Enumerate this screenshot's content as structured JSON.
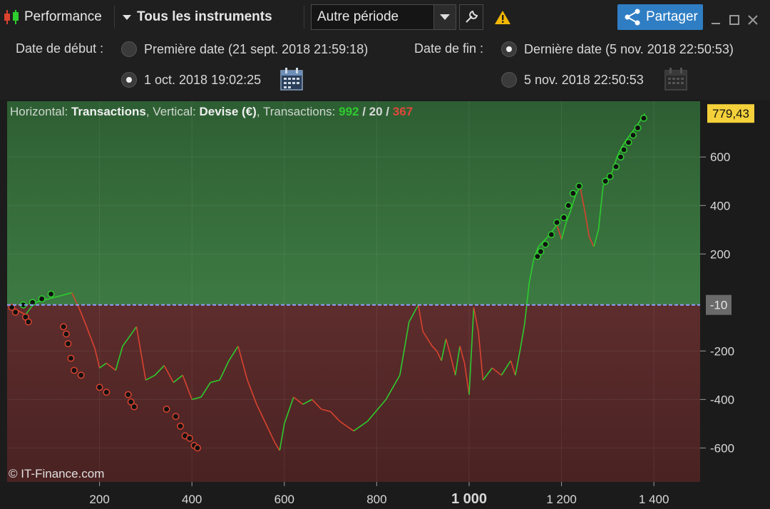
{
  "toolbar": {
    "performance_label": "Performance",
    "instruments_label": "Tous les instruments",
    "period_value": "Autre période",
    "share_label": "Partager",
    "icons": [
      "candlestick-icon",
      "caret-down-icon",
      "chevron-down-icon",
      "wrench-icon",
      "warning-icon",
      "share-icon",
      "minimize-icon",
      "maximize-icon",
      "close-icon"
    ]
  },
  "params": {
    "start_label": "Date de début :",
    "start_option_first": "Première date (21 sept. 2018 21:59:18)",
    "start_option_custom": "1 oct. 2018 19:02:25",
    "start_selected": "custom",
    "end_label": "Date de fin :",
    "end_option_last": "Dernière date (5 nov. 2018 22:50:53)",
    "end_option_custom": "5 nov. 2018 22:50:53",
    "end_selected": "last"
  },
  "chart_data": {
    "type": "line",
    "info": {
      "horizontal_label": "Horizontal: ",
      "horizontal_value": "Transactions",
      "vertical_label": ", Vertical: ",
      "vertical_value": "Devise (€)",
      "transactions_label": ", Transactions: ",
      "transactions_win": "992",
      "sep1": " / ",
      "transactions_neutral": "20",
      "sep2": " / ",
      "transactions_loss": "367"
    },
    "xlim": [
      0,
      1500
    ],
    "ylim": [
      -740,
      830
    ],
    "x_ticks": [
      200,
      400,
      600,
      800,
      1000,
      1200,
      1400
    ],
    "x_tick_labels": [
      "200",
      "400",
      "600",
      "800",
      "1 000",
      "1 200",
      "1 400"
    ],
    "y_ticks": [
      -600,
      -400,
      -200,
      200,
      400,
      600
    ],
    "y_tick_labels": [
      "-600",
      "-400",
      "-200",
      "200",
      "400",
      "600"
    ],
    "zero_line_value": -10,
    "zero_line_label": "-10",
    "last_value": 779.43,
    "last_value_label": "779,43",
    "series": [
      {
        "points": [
          [
            0,
            -10
          ],
          [
            20,
            -30
          ],
          [
            40,
            -50
          ],
          [
            60,
            0
          ],
          [
            80,
            10
          ],
          [
            100,
            20
          ],
          [
            120,
            30
          ],
          [
            140,
            40
          ],
          [
            155,
            -20
          ],
          [
            170,
            -90
          ],
          [
            190,
            -190
          ],
          [
            200,
            -270
          ],
          [
            215,
            -250
          ],
          [
            235,
            -280
          ],
          [
            250,
            -180
          ],
          [
            280,
            -100
          ],
          [
            300,
            -320
          ],
          [
            320,
            -300
          ],
          [
            340,
            -260
          ],
          [
            360,
            -330
          ],
          [
            380,
            -300
          ],
          [
            400,
            -400
          ],
          [
            420,
            -390
          ],
          [
            440,
            -330
          ],
          [
            460,
            -320
          ],
          [
            480,
            -240
          ],
          [
            500,
            -180
          ],
          [
            520,
            -320
          ],
          [
            540,
            -420
          ],
          [
            560,
            -500
          ],
          [
            580,
            -580
          ],
          [
            590,
            -610
          ],
          [
            600,
            -500
          ],
          [
            620,
            -390
          ],
          [
            640,
            -420
          ],
          [
            660,
            -400
          ],
          [
            680,
            -440
          ],
          [
            700,
            -450
          ],
          [
            720,
            -490
          ],
          [
            750,
            -530
          ],
          [
            780,
            -490
          ],
          [
            820,
            -400
          ],
          [
            850,
            -300
          ],
          [
            870,
            -80
          ],
          [
            890,
            -10
          ],
          [
            900,
            -120
          ],
          [
            920,
            -180
          ],
          [
            930,
            -200
          ],
          [
            940,
            -240
          ],
          [
            950,
            -150
          ],
          [
            960,
            -220
          ],
          [
            970,
            -300
          ],
          [
            980,
            -180
          ],
          [
            990,
            -250
          ],
          [
            1000,
            -380
          ],
          [
            1010,
            -20
          ],
          [
            1020,
            -120
          ],
          [
            1030,
            -320
          ],
          [
            1050,
            -270
          ],
          [
            1070,
            -300
          ],
          [
            1090,
            -240
          ],
          [
            1100,
            -300
          ],
          [
            1110,
            -200
          ],
          [
            1120,
            -90
          ],
          [
            1130,
            80
          ],
          [
            1140,
            180
          ],
          [
            1150,
            230
          ],
          [
            1170,
            270
          ],
          [
            1190,
            320
          ],
          [
            1200,
            260
          ],
          [
            1210,
            330
          ],
          [
            1220,
            380
          ],
          [
            1230,
            440
          ],
          [
            1240,
            480
          ],
          [
            1250,
            380
          ],
          [
            1260,
            270
          ],
          [
            1270,
            230
          ],
          [
            1280,
            300
          ],
          [
            1290,
            480
          ],
          [
            1300,
            510
          ],
          [
            1310,
            540
          ],
          [
            1320,
            600
          ],
          [
            1330,
            640
          ],
          [
            1340,
            670
          ],
          [
            1360,
            720
          ],
          [
            1380,
            779.43
          ]
        ]
      }
    ],
    "markers": [
      [
        10,
        -20
      ],
      [
        18,
        -40
      ],
      [
        35,
        -10
      ],
      [
        40,
        -60
      ],
      [
        46,
        -80
      ],
      [
        55,
        0
      ],
      [
        75,
        15
      ],
      [
        95,
        35
      ],
      [
        122,
        -100
      ],
      [
        128,
        -130
      ],
      [
        132,
        -170
      ],
      [
        138,
        -230
      ],
      [
        145,
        -280
      ],
      [
        160,
        -300
      ],
      [
        200,
        -350
      ],
      [
        215,
        -370
      ],
      [
        262,
        -380
      ],
      [
        268,
        -410
      ],
      [
        275,
        -430
      ],
      [
        345,
        -440
      ],
      [
        365,
        -470
      ],
      [
        375,
        -510
      ],
      [
        385,
        -550
      ],
      [
        395,
        -560
      ],
      [
        405,
        -590
      ],
      [
        412,
        -600
      ],
      [
        1148,
        190
      ],
      [
        1155,
        210
      ],
      [
        1165,
        240
      ],
      [
        1178,
        280
      ],
      [
        1190,
        330
      ],
      [
        1205,
        350
      ],
      [
        1215,
        400
      ],
      [
        1225,
        450
      ],
      [
        1238,
        480
      ],
      [
        1295,
        500
      ],
      [
        1305,
        520
      ],
      [
        1318,
        560
      ],
      [
        1328,
        600
      ],
      [
        1335,
        630
      ],
      [
        1345,
        660
      ],
      [
        1355,
        690
      ],
      [
        1365,
        720
      ],
      [
        1378,
        760
      ]
    ],
    "positive_zone_color": "#3a6e3d",
    "negative_zone_color": "#5a2a2a",
    "up_color": "#2ecc2e",
    "down_color": "#d9432f"
  },
  "copyright": "© IT-Finance.com"
}
